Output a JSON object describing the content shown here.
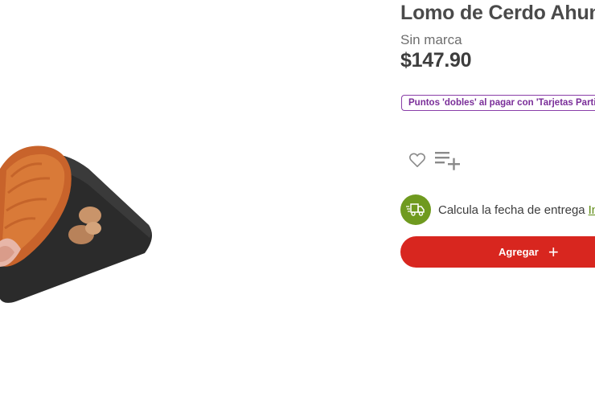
{
  "product": {
    "title": "Lomo de Cerdo Ahumado",
    "brand": "Sin marca",
    "price": "$147.90",
    "promo": "Puntos 'dobles' al pagar con 'Tarjetas Participantes'"
  },
  "actions": {
    "favorite_icon": "heart-icon",
    "add_to_list_icon": "playlist-add-icon"
  },
  "delivery": {
    "icon": "delivery-truck-icon",
    "text": "Calcula la fecha de entrega",
    "link": "Ingresa tu C.P."
  },
  "cart": {
    "add_label": "Agregar",
    "plus_symbol": "+"
  },
  "colors": {
    "add_button": "#d8261f",
    "delivery_green": "#6f9a1f",
    "promo_purple": "#7a2e99"
  }
}
